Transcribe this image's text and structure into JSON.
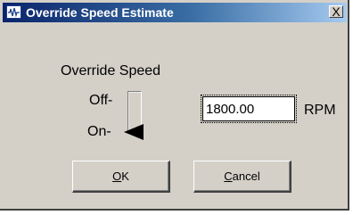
{
  "window": {
    "title": "Override Speed Estimate",
    "close_label": "X",
    "icon": "waveform-icon",
    "titlebar_color": "#0a246a"
  },
  "override": {
    "group_label": "Override Speed",
    "off_label": "Off-",
    "on_label": "On-",
    "slider_state": "On"
  },
  "speed": {
    "value": "1800.00",
    "unit": "RPM"
  },
  "buttons": {
    "ok_mnemonic": "O",
    "ok_rest": "K",
    "cancel_mnemonic": "C",
    "cancel_rest": "ancel"
  }
}
